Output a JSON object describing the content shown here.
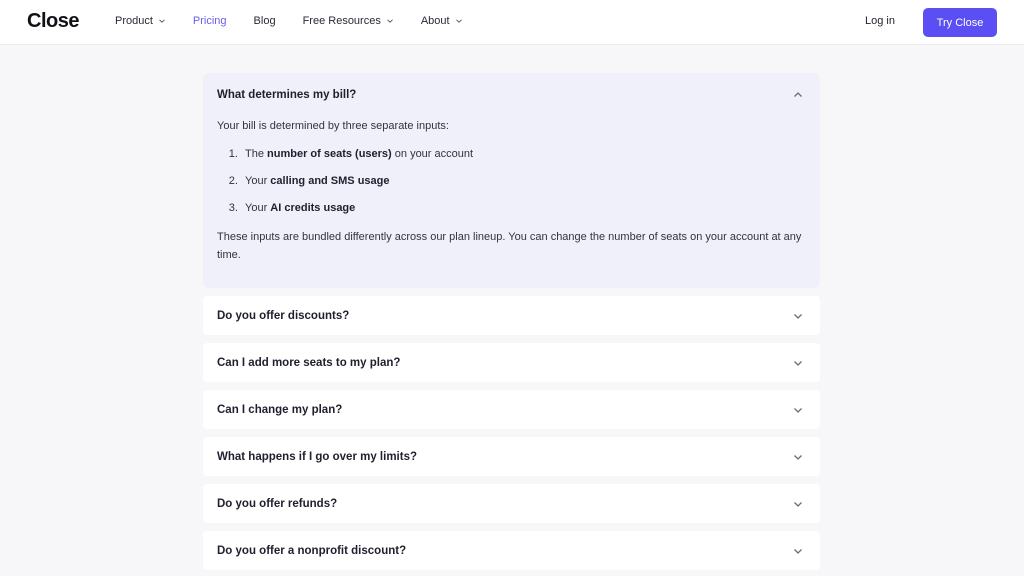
{
  "header": {
    "logo": "Close",
    "nav": [
      {
        "label": "Product",
        "dropdown": true,
        "active": false
      },
      {
        "label": "Pricing",
        "dropdown": false,
        "active": true
      },
      {
        "label": "Blog",
        "dropdown": false,
        "active": false
      },
      {
        "label": "Free Resources",
        "dropdown": true,
        "active": false
      },
      {
        "label": "About",
        "dropdown": true,
        "active": false
      }
    ],
    "login_label": "Log in",
    "cta_label": "Try Close"
  },
  "faq": {
    "open_item": {
      "question": "What determines my bill?",
      "intro": "Your bill is determined by three separate inputs:",
      "list": [
        {
          "prefix": "The ",
          "bold": "number of seats (users)",
          "suffix": " on your account"
        },
        {
          "prefix": "Your ",
          "bold": "calling and SMS usage",
          "suffix": ""
        },
        {
          "prefix": "Your ",
          "bold": "AI credits usage",
          "suffix": ""
        }
      ],
      "outro": "These inputs are bundled differently across our plan lineup. You can change the number of seats on your account at any time."
    },
    "items": [
      {
        "question": "Do you offer discounts?"
      },
      {
        "question": "Can I add more seats to my plan?"
      },
      {
        "question": "Can I change my plan?"
      },
      {
        "question": "What happens if I go over my limits?"
      },
      {
        "question": "Do you offer refunds?"
      },
      {
        "question": "Do you offer a nonprofit discount?"
      }
    ]
  },
  "colors": {
    "accent": "#5b4ef2",
    "active_nav": "#6b5cf0",
    "open_panel_bg": "#f0f0fb",
    "page_bg": "#f7f7f9"
  },
  "icons": {
    "nav_dropdown": "chevron-down-icon",
    "faq_open": "chevron-up-icon",
    "faq_closed": "chevron-down-icon"
  }
}
